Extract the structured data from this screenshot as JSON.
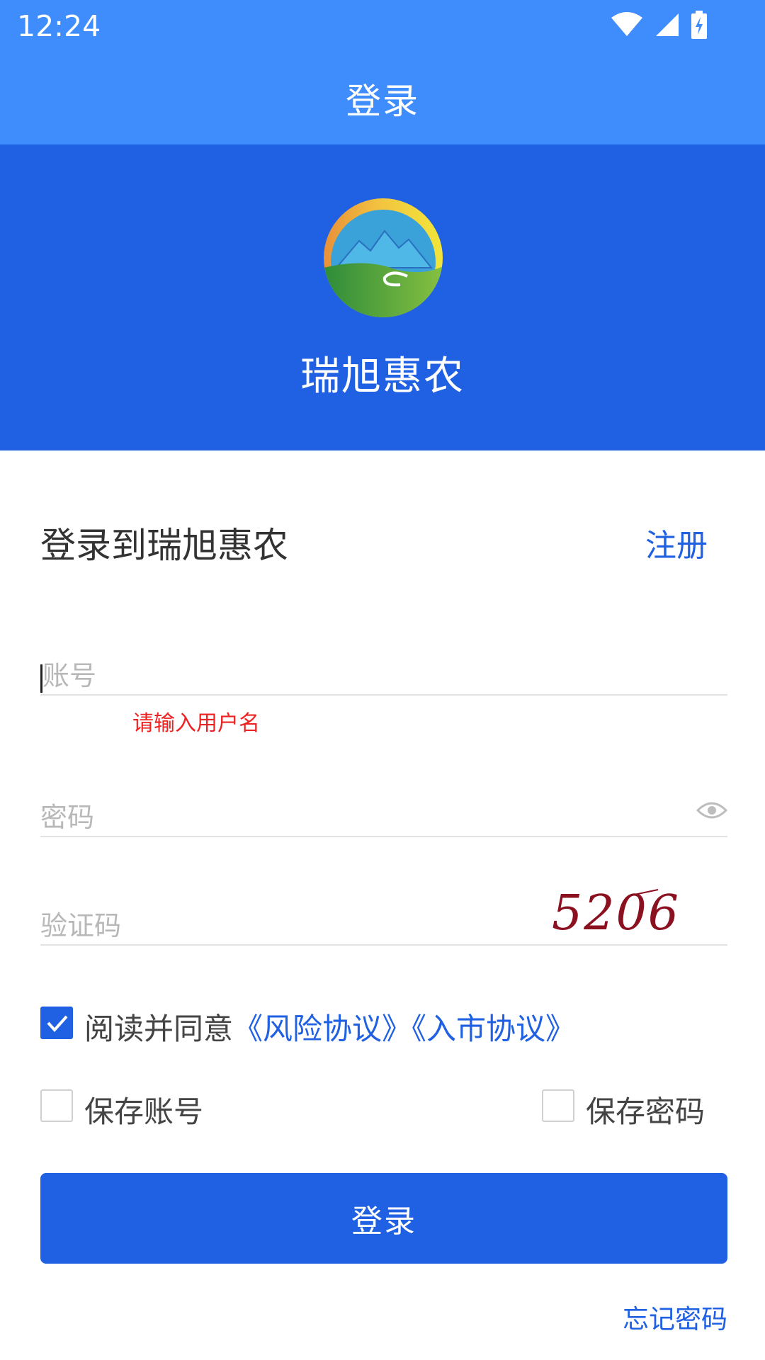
{
  "status_bar": {
    "time": "12:24"
  },
  "app_bar": {
    "title": "登录"
  },
  "hero": {
    "app_name": "瑞旭惠农"
  },
  "form": {
    "heading": "登录到瑞旭惠农",
    "register_link": "注册",
    "account": {
      "placeholder": "账号",
      "value": "",
      "error": "请输入用户名"
    },
    "password": {
      "placeholder": "密码",
      "value": ""
    },
    "captcha": {
      "placeholder": "验证码",
      "value": "",
      "image_code": "5206"
    },
    "agreement": {
      "checked": true,
      "prefix": "阅读并同意",
      "risk_link": "《风险协议》",
      "market_link": "《入市协议》"
    },
    "save_account": {
      "label": "保存账号",
      "checked": false
    },
    "save_password": {
      "label": "保存密码",
      "checked": false
    },
    "login_button": "登录",
    "forgot_password": "忘记密码"
  },
  "colors": {
    "header": "#3f8cfd",
    "hero": "#2060e2",
    "link": "#2060e2",
    "error": "#ee2222"
  }
}
